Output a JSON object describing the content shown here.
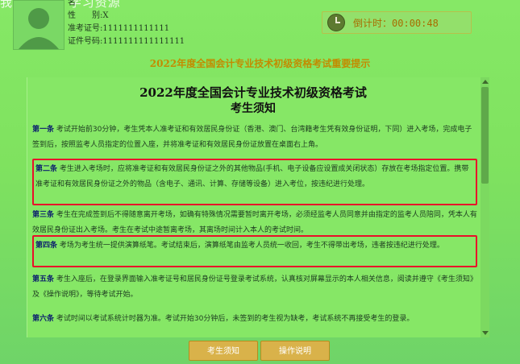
{
  "watermark": "我要自学网 学习资源",
  "candidate": {
    "name_label": "名",
    "name_value": "",
    "gender_label": "性　　别",
    "gender_value": ":X",
    "ticket_label": "准考证号",
    "ticket_value": ":1111111111111",
    "id_label": "证件号码",
    "id_value": ":1111111111111111"
  },
  "timer": {
    "label": "倒计时：",
    "value": "00:00:48"
  },
  "banner_title": "2022年度全国会计专业技术初级资格考试重要提示",
  "doc": {
    "title_line1": "2022年度全国会计专业技术初级资格考试",
    "title_line2": "考生须知",
    "rules": [
      {
        "head": "第一条",
        "text": " 考试开始前30分钟，考生凭本人准考证和有效居民身份证（香港、澳门、台湾籍考生凭有效身份证明，下同）进入考场，完成电子签到后，按照监考人员指定的位置入座，并将准考证和有效居民身份证放置在桌面右上角。"
      },
      {
        "head": "第二条",
        "text": " 考生进入考场时，应将准考证和有效居民身份证之外的其他物品(手机、电子设备应设置成关闭状态）存放在考场指定位置。携带准考证和有效居民身份证之外的物品（含电子、通讯、计算、存储等设备）进入考位，按违纪进行处理。"
      },
      {
        "head": "第三条",
        "text": " 考生在完成签到后不得随意离开考场，如确有特殊情况需要暂时离开考场，必须经监考人员同意并由指定的监考人员陪同，凭本人有效居民身份证出入考场。考生在考试中途暂离考场，其离场时间计入本人的考试时间。"
      },
      {
        "head": "第四条",
        "text": " 考场为考生统一提供演算纸笔。考试结束后，演算纸笔由监考人员统一收回，考生不得带出考场，违者按违纪进行处理。"
      },
      {
        "head": "第五条",
        "text": " 考生入座后，在登录界面输入准考证号和居民身份证号登录考试系统，认真核对屏幕显示的本人相关信息，阅读并遵守《考生须知》及《操作说明》，等待考试开始。"
      },
      {
        "head": "第六条",
        "text": " 考试时间以考试系统计时器为准。考试开始30分钟后，未签到的考生视为缺考，考试系统不再接受考生的登录。"
      }
    ]
  },
  "buttons": {
    "notice": "考生须知",
    "instructions": "操作说明"
  }
}
